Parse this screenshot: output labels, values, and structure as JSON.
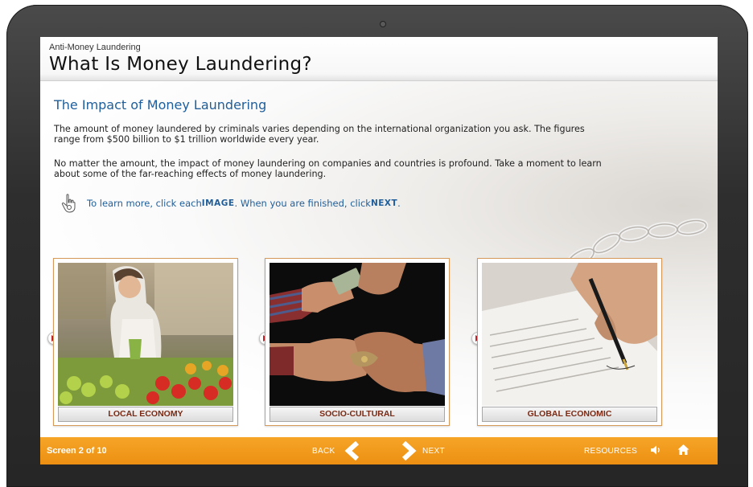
{
  "course": "Anti-Money Laundering",
  "page_title": "What Is Money Laundering?",
  "section_title": "The Impact of Money Laundering",
  "paragraphs": [
    "The amount of money laundered by criminals varies depending on the international organization you ask. The figures range from $500 billion to $1 trillion worldwide every year.",
    "No matter the amount, the impact of money laundering on companies and countries is profound. Take a moment to learn about some of the far-reaching effects of money laundering."
  ],
  "instruction": {
    "part1": "To learn more, click each ",
    "keyword1": "IMAGE",
    "part2": ". When you are finished, click ",
    "keyword2": "NEXT",
    "part3": "."
  },
  "cards": [
    {
      "label": "LOCAL ECONOMY"
    },
    {
      "label": "SOCIO-CULTURAL"
    },
    {
      "label": "GLOBAL ECONOMIC"
    }
  ],
  "footer": {
    "screen_count": "Screen 2 of 10",
    "back": "BACK",
    "next": "NEXT",
    "resources": "RESOURCES"
  },
  "colors": {
    "accent_orange": "#f29b1d",
    "heading_blue": "#1f5e9a",
    "card_label": "#7a2a14"
  }
}
